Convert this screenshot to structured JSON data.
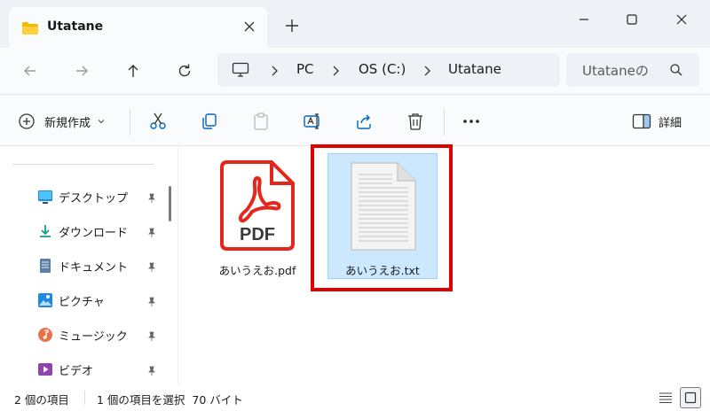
{
  "window": {
    "tab_title": "Utatane",
    "accent": "#0067c0"
  },
  "address": {
    "segments": [
      "PC",
      "OS (C:)",
      "Utatane"
    ],
    "search_placeholder": "Utataneの"
  },
  "toolbar": {
    "new_label": "新規作成",
    "detail_label": "詳細"
  },
  "sidebar": {
    "items": [
      {
        "label": "デスクトップ",
        "icon": "desktop-icon"
      },
      {
        "label": "ダウンロード",
        "icon": "download-icon"
      },
      {
        "label": "ドキュメント",
        "icon": "documents-icon"
      },
      {
        "label": "ピクチャ",
        "icon": "pictures-icon"
      },
      {
        "label": "ミュージック",
        "icon": "music-icon"
      },
      {
        "label": "ビデオ",
        "icon": "videos-icon"
      }
    ]
  },
  "files": [
    {
      "name": "あいうえお.pdf",
      "icon": "pdf-file-icon",
      "icon_text": "PDF",
      "selected": false
    },
    {
      "name": "あいうえお.txt",
      "icon": "text-file-icon",
      "selected": true
    }
  ],
  "status": {
    "item_count": "2 個の項目",
    "selection": "1 個の項目を選択  70 バイト"
  },
  "colors": {
    "highlight": "#e00000",
    "selection_bg": "#cce8ff",
    "pdf_red": "#e4261c"
  }
}
